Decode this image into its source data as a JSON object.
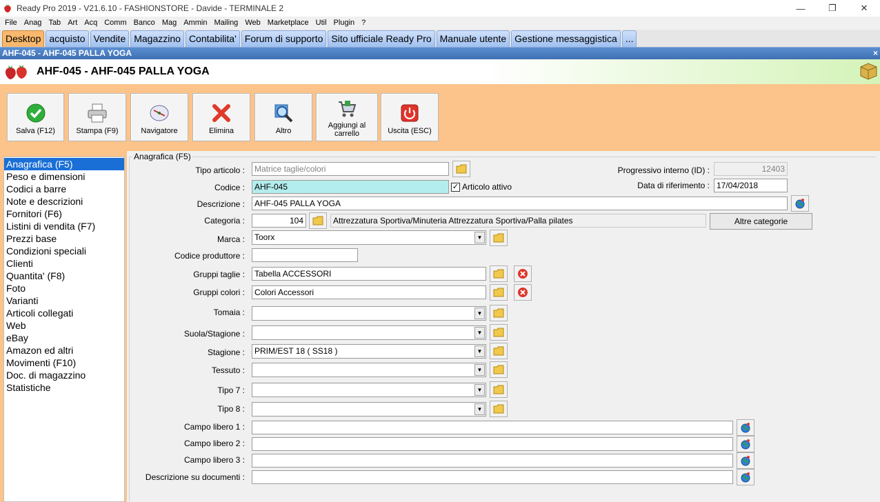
{
  "window": {
    "title": "Ready Pro 2019 - V21.6.10 - FASHIONSTORE - Davide - TERMINALE 2",
    "minimize": "—",
    "restore": "❐",
    "close": "✕"
  },
  "menu": [
    "File",
    "Anag",
    "Tab",
    "Art",
    "Acq",
    "Comm",
    "Banco",
    "Mag",
    "Ammin",
    "Mailing",
    "Web",
    "Marketplace",
    "Util",
    "Plugin",
    "?"
  ],
  "tabs": [
    "Desktop",
    "acquisto",
    "Vendite",
    "Magazzino",
    "Contabilita'",
    "Forum di supporto",
    "Sito ufficiale Ready Pro",
    "Manuale utente",
    "Gestione messaggistica",
    "..."
  ],
  "active_tab": "Desktop",
  "caption": {
    "text": "AHF-045 - AHF-045 PALLA YOGA",
    "close": "×"
  },
  "header": {
    "title": "AHF-045 - AHF-045 PALLA YOGA"
  },
  "toolbar": {
    "save": "Salva (F12)",
    "print": "Stampa (F9)",
    "navigator": "Navigatore",
    "delete": "Elimina",
    "other": "Altro",
    "add_cart_1": "Aggiungi al",
    "add_cart_2": "carrello",
    "exit": "Uscita (ESC)"
  },
  "nav": [
    "Anagrafica (F5)",
    "Peso e dimensioni",
    "Codici a barre",
    "Note e descrizioni",
    "Fornitori (F6)",
    "Listini di vendita (F7)",
    "Prezzi base",
    "Condizioni speciali",
    "Clienti",
    "Quantita' (F8)",
    "Foto",
    "Varianti",
    "Articoli collegati",
    "Web",
    "eBay",
    "Amazon ed altri",
    "Movimenti (F10)",
    "Doc. di magazzino",
    "Statistiche"
  ],
  "form": {
    "group_title": "Anagrafica (F5)",
    "tipo_articolo_label": "Tipo articolo :",
    "tipo_articolo_value": "Matrice taglie/colori",
    "codice_label": "Codice :",
    "codice_value": "AHF-045",
    "articolo_attivo_label": "Articolo attivo",
    "articolo_attivo_checked": "✓",
    "progressivo_label": "Progressivo interno (ID) :",
    "progressivo_value": "12403",
    "data_label": "Data di riferimento :",
    "data_value": "17/04/2018",
    "descrizione_label": "Descrizione :",
    "descrizione_value": "AHF-045 PALLA YOGA",
    "categoria_label": "Categoria :",
    "categoria_code": "104",
    "categoria_path": "Attrezzatura Sportiva/Minuteria Attrezzatura Sportiva/Palla pilates",
    "altre_categorie": "Altre categorie",
    "marca_label": "Marca :",
    "marca_value": "Toorx",
    "codice_produttore_label": "Codice produttore :",
    "codice_produttore_value": "",
    "gruppi_taglie_label": "Gruppi taglie :",
    "gruppi_taglie_value": "Tabella  ACCESSORI",
    "gruppi_colori_label": "Gruppi colori :",
    "gruppi_colori_value": "Colori Accessori",
    "tomaia_label": "Tomaia :",
    "tomaia_value": "",
    "suola_label": "Suola/Stagione  :",
    "suola_value": "",
    "stagione_label": "Stagione :",
    "stagione_value": "PRIM/EST 18 ( SS18 )",
    "tessuto_label": "Tessuto :",
    "tessuto_value": "",
    "tipo7_label": "Tipo 7 :",
    "tipo7_value": "",
    "tipo8_label": "Tipo 8 :",
    "tipo8_value": "",
    "campo1_label": "Campo libero 1 :",
    "campo1_value": "",
    "campo2_label": "Campo libero 2 :",
    "campo2_value": "",
    "campo3_label": "Campo libero 3 :",
    "campo3_value": "",
    "descr_doc_label": "Descrizione su documenti :",
    "descr_doc_value": ""
  },
  "colors": {
    "work_bg": "#fcc38a",
    "active_tab": "#f9b86d",
    "caption": "#3e6fb3",
    "selected_nav": "#1a6fd6",
    "codice_bg": "#b3eded"
  }
}
